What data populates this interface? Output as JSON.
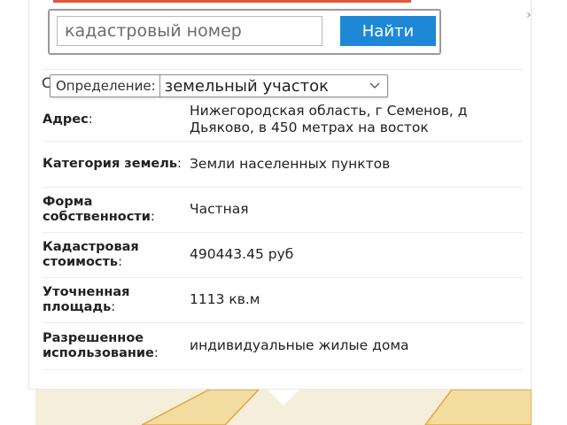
{
  "search": {
    "placeholder": "кадастровый номер",
    "button_label": "Найти"
  },
  "close_glyph": "›",
  "definition": {
    "hidden_letter": "С",
    "label": "Определение:",
    "selected_value": "земельный участок"
  },
  "rows": [
    {
      "key": "Адрес",
      "colon": ":",
      "value": "Нижегородская область, г Семенов, д Дьяково, в 450 метрах на восток"
    },
    {
      "key": "Категория земель",
      "colon": ":",
      "value": "Земли населенных пунктов"
    },
    {
      "key": "Форма собственности",
      "colon": ":",
      "value": "Частная"
    },
    {
      "key": "Кадастровая стоимость",
      "colon": ":",
      "value": "490443.45 руб"
    },
    {
      "key": "Уточненная площадь",
      "colon": ":",
      "value": "1113 кв.м"
    },
    {
      "key": "Разрешенное использование",
      "colon": ":",
      "value": "индивидуальные жилые дома"
    }
  ],
  "colors": {
    "accent": "#1e88d6",
    "top_strip": "#e05a3a",
    "map_bg": "#f5eeda",
    "parcel_fill": "#f3dca0",
    "parcel_line": "#e3a63c"
  }
}
